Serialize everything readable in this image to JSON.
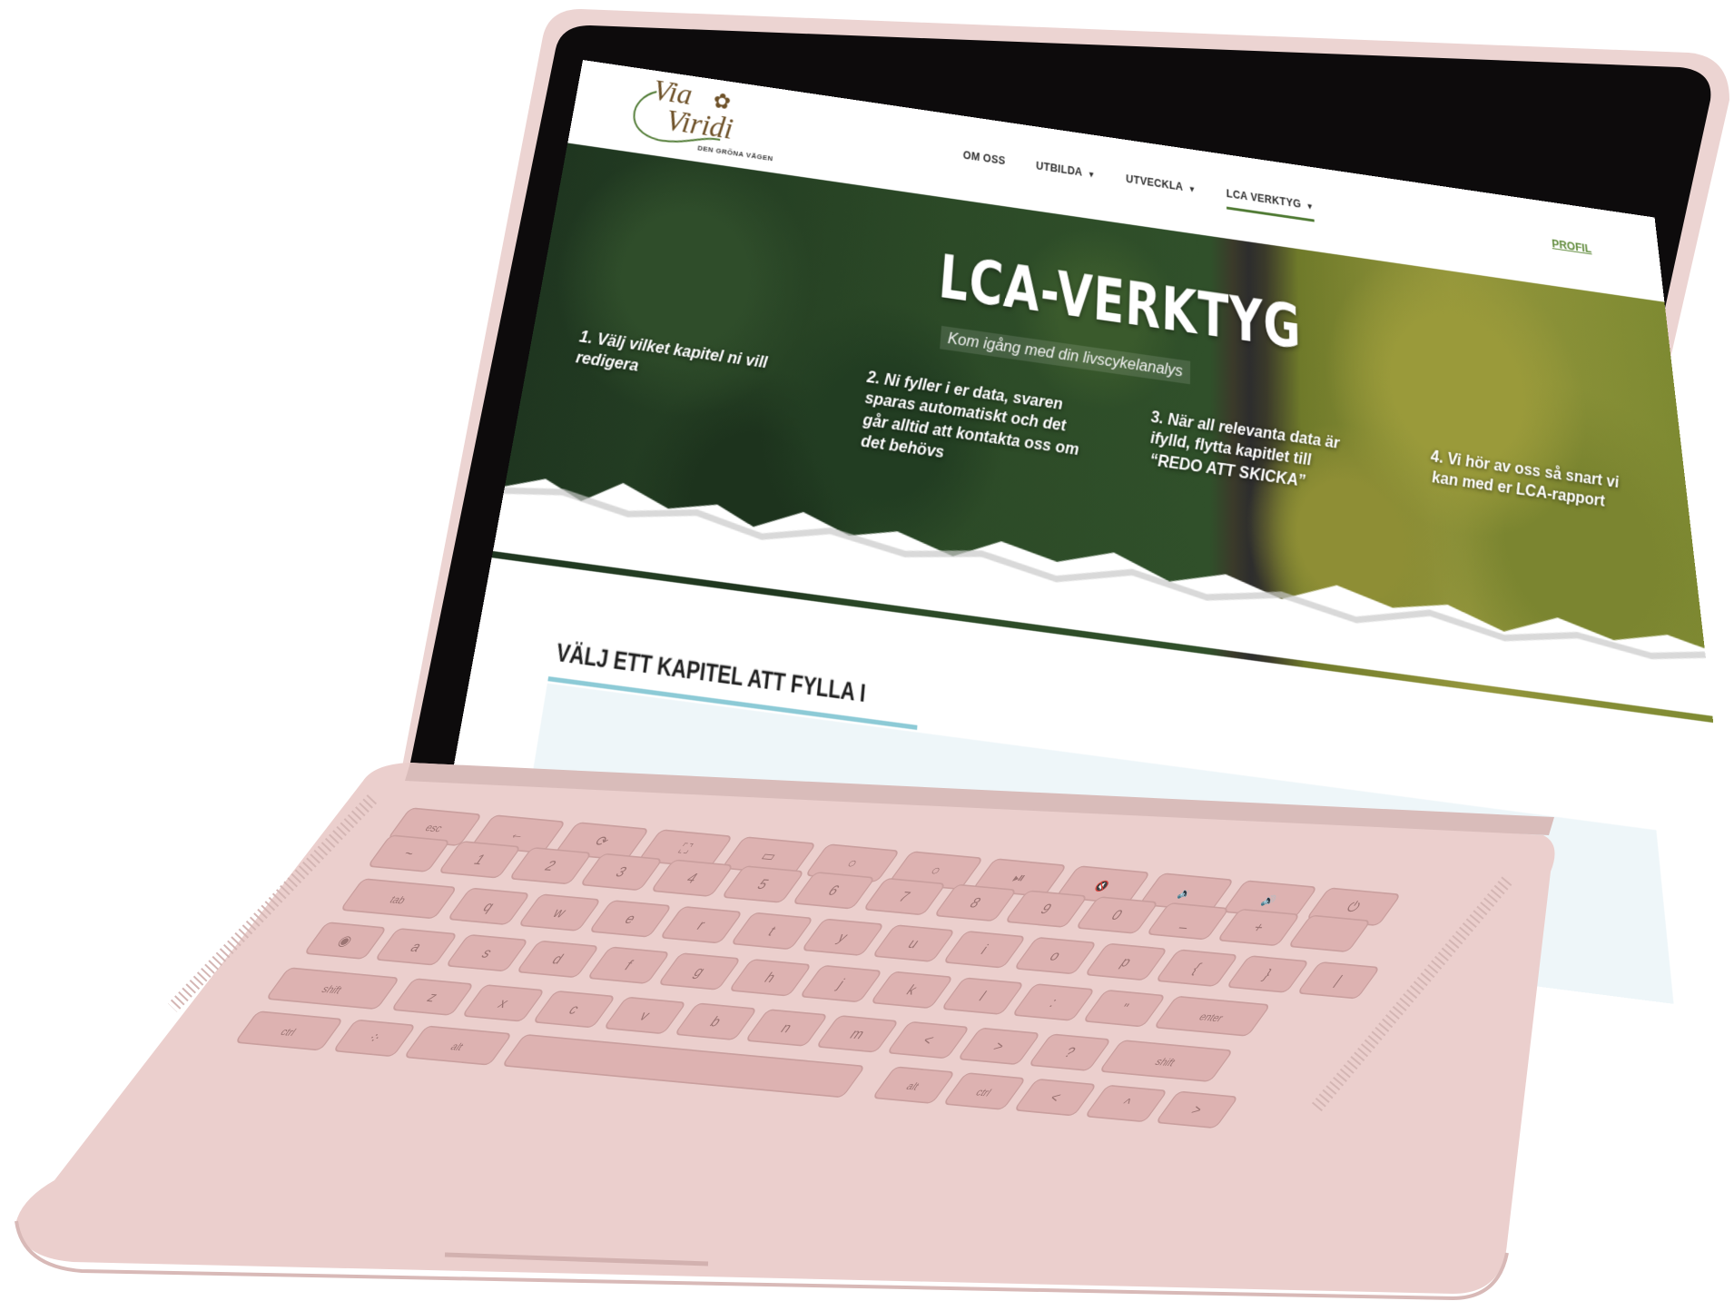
{
  "site": {
    "logo": {
      "word1": "Via",
      "word2": "Viridi",
      "tagline": "DEN GRÖNA VÄGEN"
    },
    "nav": {
      "items": [
        {
          "label": "OM OSS",
          "has_dropdown": false,
          "active": false
        },
        {
          "label": "UTBILDA",
          "has_dropdown": true,
          "active": false
        },
        {
          "label": "UTVECKLA",
          "has_dropdown": true,
          "active": false
        },
        {
          "label": "LCA VERKTYG",
          "has_dropdown": true,
          "active": true
        }
      ],
      "profile": "PROFIL"
    },
    "hero": {
      "title": "LCA-VERKTYG",
      "subtitle": "Kom igång med din livscykelanalys",
      "steps": [
        "1. Välj vilket kapitel ni vill redigera",
        "2. Ni fyller i er data, svaren sparas automatiskt och det går alltid att kontakta oss om det behövs",
        "3. När all relevanta data är ifylld, flytta kapitlet till “REDO ATT SKICKA”",
        "4. Vi hör av oss så snart vi kan med er LCA-rapport"
      ]
    },
    "section": {
      "title": "VÄLJ ETT KAPITEL ATT FYLLA I"
    }
  },
  "colors": {
    "laptop_body": "#ecd4d2",
    "bezel": "#0d0b0c",
    "keys": "#ddb2b1",
    "nav_active_underline": "#4f7a33",
    "profile_link": "#5f8a3a",
    "logo_brown": "#6e5128",
    "section_underline": "#8ccad6"
  },
  "keyboard": {
    "rows": [
      [
        "esc",
        "←",
        "⟳",
        "⛶",
        "▭",
        "○",
        "○",
        "⏯",
        "🔇",
        "🔉",
        "🔊",
        "⏻"
      ],
      [
        "~",
        "1",
        "2",
        "3",
        "4",
        "5",
        "6",
        "7",
        "8",
        "9",
        "0",
        "_",
        "+",
        ""
      ],
      [
        "tab",
        "q",
        "w",
        "e",
        "r",
        "t",
        "y",
        "u",
        "i",
        "o",
        "p",
        "{",
        "}",
        "|"
      ],
      [
        "◉",
        "a",
        "s",
        "d",
        "f",
        "g",
        "h",
        "j",
        "k",
        "l",
        ":",
        "\"",
        "enter"
      ],
      [
        "shift",
        "z",
        "x",
        "c",
        "v",
        "b",
        "n",
        "m",
        "<",
        ">",
        "?",
        "shift"
      ],
      [
        "ctrl",
        "⁘",
        "alt",
        "",
        "alt",
        "ctrl",
        "<",
        "^",
        ">"
      ]
    ]
  }
}
